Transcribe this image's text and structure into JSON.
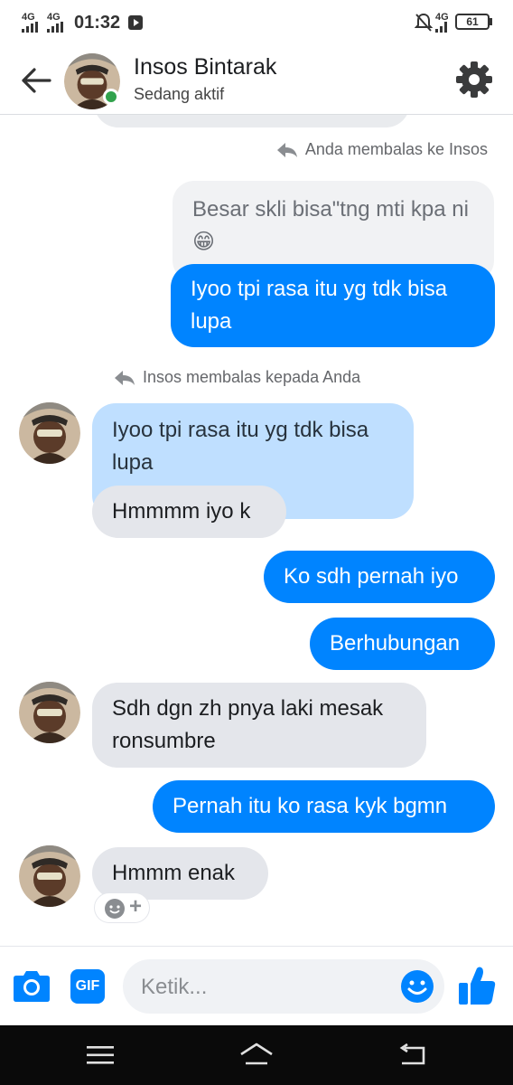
{
  "status_bar": {
    "time": "01:32",
    "network_1": "4G",
    "network_2": "4G",
    "network_3": "4G",
    "battery": "61"
  },
  "header": {
    "contact_name": "Insos Bintarak",
    "status": "Sedang aktif"
  },
  "thread": {
    "reply_note_1": "Anda membalas ke Insos",
    "quoted_1": "Besar skli bisa\"tng mti kpa ni😁",
    "msg_1": "Iyoo tpi rasa itu yg tdk bisa lupa",
    "reply_note_2": "Insos membalas kepada Anda",
    "quoted_2": "Iyoo tpi rasa itu yg tdk bisa lupa",
    "msg_2": "Hmmmm iyo k",
    "msg_3": "Ko sdh pernah iyo",
    "msg_4": "Berhubungan",
    "msg_5": "Sdh dgn zh pnya laki mesak ronsumbre",
    "msg_6": "Pernah itu ko rasa kyk bgmn",
    "msg_7": "Hmmm enak",
    "react_plus": "+"
  },
  "composer": {
    "placeholder": "Ketik...",
    "gif_label": "GIF"
  },
  "colors": {
    "accent": "#0084ff",
    "outgoing_bubble": "#0084ff",
    "incoming_bubble": "#e4e6eb",
    "quoted_incoming": "#bfdfff",
    "online": "#31a24c"
  },
  "icons": [
    "back-arrow-icon",
    "gear-icon",
    "reply-icon",
    "camera-icon",
    "gif-icon",
    "emoji-icon",
    "thumbs-up-icon",
    "menu-icon",
    "home-icon",
    "back-icon"
  ]
}
